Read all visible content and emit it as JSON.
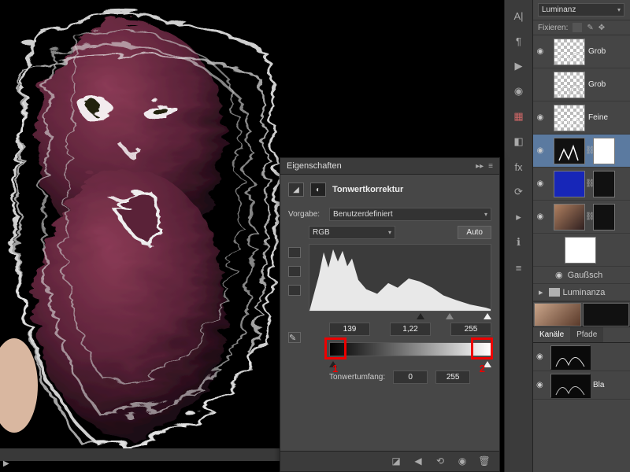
{
  "properties": {
    "panel_title": "Eigenschaften",
    "adjustment_name": "Tonwertkorrektur",
    "preset_label": "Vorgabe:",
    "preset_value": "Benutzerdefiniert",
    "channel_value": "RGB",
    "auto_label": "Auto",
    "input_levels": {
      "black": "139",
      "mid": "1,22",
      "white": "255"
    },
    "output_label": "Tonwertumfang:",
    "output_levels": {
      "black": "0",
      "white": "255"
    },
    "annotations": {
      "left": "1",
      "right": "2"
    }
  },
  "layers_panel": {
    "blend_mode": "Luminanz",
    "lock_label": "Fixieren:",
    "layers": [
      {
        "name": "Grob",
        "selected": false,
        "visible": true,
        "kind": "pixel"
      },
      {
        "name": "Grob",
        "selected": false,
        "visible": false,
        "kind": "pixel"
      },
      {
        "name": "Feine",
        "selected": false,
        "visible": true,
        "kind": "pixel"
      },
      {
        "name": "",
        "selected": true,
        "visible": true,
        "kind": "levels"
      },
      {
        "name": "",
        "selected": false,
        "visible": true,
        "kind": "solid"
      },
      {
        "name": "",
        "selected": false,
        "visible": true,
        "kind": "photo"
      },
      {
        "name": "",
        "selected": false,
        "visible": true,
        "kind": "white"
      }
    ],
    "smart_filter_label": "Gaußsch",
    "group_label": "Luminanza"
  },
  "tabs": {
    "channels": "Kanäle",
    "paths": "Pfade"
  },
  "channels": [
    {
      "name": ""
    },
    {
      "name": "Bla"
    }
  ]
}
